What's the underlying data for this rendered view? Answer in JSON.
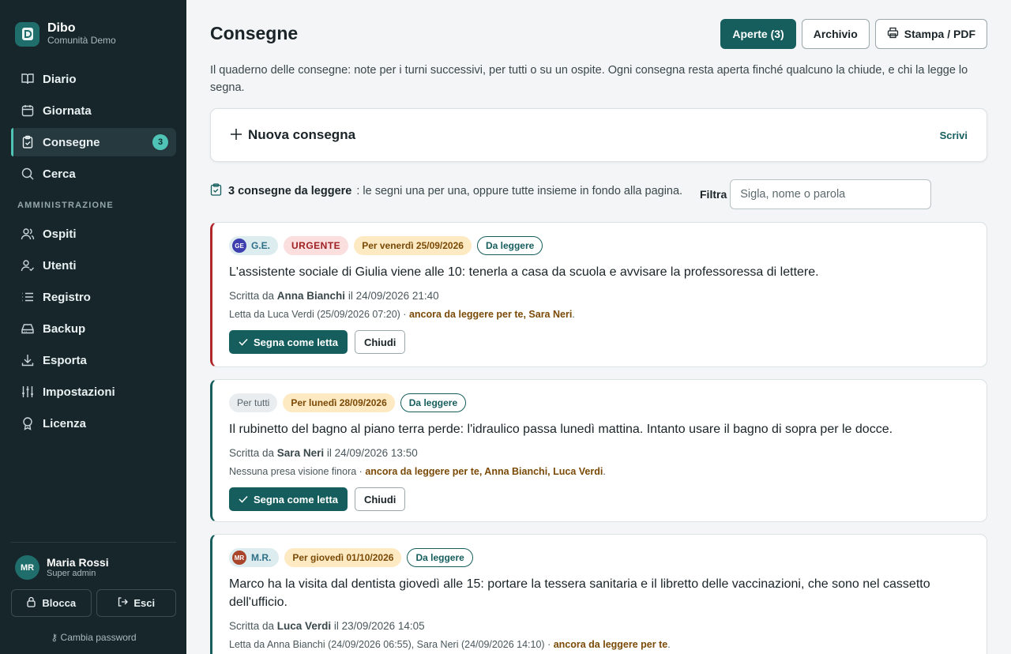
{
  "app": {
    "name": "Dibo",
    "community": "Comunità Demo"
  },
  "nav": {
    "items": [
      {
        "label": "Diario",
        "icon": "book-icon"
      },
      {
        "label": "Giornata",
        "icon": "calendar-icon"
      },
      {
        "label": "Consegne",
        "icon": "clipboard-check-icon",
        "badge": "3",
        "active": true
      },
      {
        "label": "Cerca",
        "icon": "search-icon"
      }
    ],
    "admin_section": "AMMINISTRAZIONE",
    "admin_items": [
      {
        "label": "Ospiti",
        "icon": "users-icon"
      },
      {
        "label": "Utenti",
        "icon": "user-check-icon"
      },
      {
        "label": "Registro",
        "icon": "list-icon"
      },
      {
        "label": "Backup",
        "icon": "hard-drive-icon"
      },
      {
        "label": "Esporta",
        "icon": "download-icon"
      },
      {
        "label": "Impostazioni",
        "icon": "sliders-icon"
      },
      {
        "label": "Licenza",
        "icon": "award-icon"
      }
    ]
  },
  "user": {
    "initials": "MR",
    "name": "Maria Rossi",
    "role": "Super admin",
    "lock_label": "Blocca",
    "logout_label": "Esci",
    "change_password": "Cambia password"
  },
  "header": {
    "title": "Consegne",
    "open_button": "Aperte (3)",
    "archive_button": "Archivio",
    "print_button": "Stampa / PDF",
    "intro": "Il quaderno delle consegne: note per i turni successivi, per tutti o su un ospite. Ogni consegna resta aperta finché qualcuno la chiude, e chi la legge lo segna."
  },
  "new_handover": {
    "title": "Nuova consegna",
    "action": "Scrivi"
  },
  "summary": {
    "count_text": "3 consegne da leggere",
    "hint": ": le segni una per una, oppure tutte insieme in fondo alla pagina.",
    "filter_label": "Filtra",
    "filter_placeholder": "Sigla, nome o parola"
  },
  "colors": {
    "accent": "#165e5e",
    "urgent": "#b0262b",
    "sidebar": "#17262b",
    "badge": "#4fc3b6"
  },
  "cards": [
    {
      "guest_initials": "GE",
      "guest_tag": "G.E.",
      "guest_color": "#3e3fae",
      "urgent_tag": "URGENTE",
      "due_tag": "Per venerdì 25/09/2026",
      "status_tag": "Da leggere",
      "text": "L'assistente sociale di Giulia viene alle 10: tenerla a casa da scuola e avvisare la professoressa di lettere.",
      "author_prefix": "Scritta da",
      "author": "Anna Bianchi",
      "author_suffix": "il 24/09/2026 21:40",
      "read_by": "Letta da Luca Verdi (25/09/2026 07:20) · ",
      "pending": "ancora da leggere per te, Sara Neri",
      "mark_read": "Segna come letta",
      "close": "Chiudi"
    },
    {
      "all_tag": "Per tutti",
      "due_tag": "Per lunedì 28/09/2026",
      "status_tag": "Da leggere",
      "text": "Il rubinetto del bagno al piano terra perde: l'idraulico passa lunedì mattina. Intanto usare il bagno di sopra per le docce.",
      "author_prefix": "Scritta da",
      "author": "Sara Neri",
      "author_suffix": "il 24/09/2026 13:50",
      "read_by": "Nessuna presa visione finora · ",
      "pending": "ancora da leggere per te, Anna Bianchi, Luca Verdi",
      "mark_read": "Segna come letta",
      "close": "Chiudi"
    },
    {
      "guest_initials": "MR",
      "guest_tag": "M.R.",
      "guest_color": "#a8452b",
      "due_tag": "Per giovedì 01/10/2026",
      "status_tag": "Da leggere",
      "text": "Marco ha la visita dal dentista giovedì alle 15: portare la tessera sanitaria e il libretto delle vaccinazioni, che sono nel cassetto dell'ufficio.",
      "author_prefix": "Scritta da",
      "author": "Luca Verdi",
      "author_suffix": "il 23/09/2026 14:05",
      "read_by": "Letta da Anna Bianchi (24/09/2026 06:55), Sara Neri (24/09/2026 14:10) · ",
      "pending": "ancora da leggere per te"
    }
  ]
}
